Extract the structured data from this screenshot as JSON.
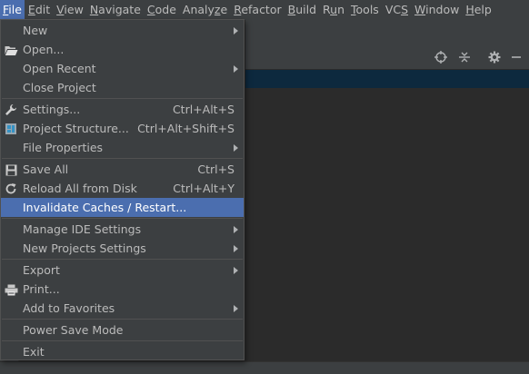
{
  "menubar": {
    "items": [
      "File",
      "Edit",
      "View",
      "Navigate",
      "Code",
      "Analyze",
      "Refactor",
      "Build",
      "Run",
      "Tools",
      "VCS",
      "Window",
      "Help"
    ],
    "active": "File"
  },
  "file_menu": {
    "new": {
      "label": "New"
    },
    "open": {
      "label": "Open..."
    },
    "open_recent": {
      "label": "Open Recent"
    },
    "close_project": {
      "label": "Close Project"
    },
    "settings": {
      "label": "Settings...",
      "shortcut": "Ctrl+Alt+S"
    },
    "project_structure": {
      "label": "Project Structure...",
      "shortcut": "Ctrl+Alt+Shift+S"
    },
    "file_properties": {
      "label": "File Properties"
    },
    "save_all": {
      "label": "Save All",
      "shortcut": "Ctrl+S"
    },
    "reload_all": {
      "label": "Reload All from Disk",
      "shortcut": "Ctrl+Alt+Y"
    },
    "invalidate_caches": {
      "label": "Invalidate Caches / Restart..."
    },
    "manage_ide_settings": {
      "label": "Manage IDE Settings"
    },
    "new_projects_settings": {
      "label": "New Projects Settings"
    },
    "export": {
      "label": "Export"
    },
    "print": {
      "label": "Print..."
    },
    "add_to_favorites": {
      "label": "Add to Favorites"
    },
    "power_save_mode": {
      "label": "Power Save Mode"
    },
    "exit": {
      "label": "Exit"
    }
  },
  "colors": {
    "menu_bg": "#3c3f41",
    "highlight": "#4b6eaf",
    "editor_bg": "#2b2b2b",
    "text": "#bbbbbb"
  },
  "icons": [
    "folder-open-icon",
    "wrench-icon",
    "project-structure-icon",
    "save-icon",
    "reload-icon",
    "printer-icon",
    "crosshair-icon",
    "collapse-icon",
    "gear-icon",
    "minimize-icon"
  ]
}
